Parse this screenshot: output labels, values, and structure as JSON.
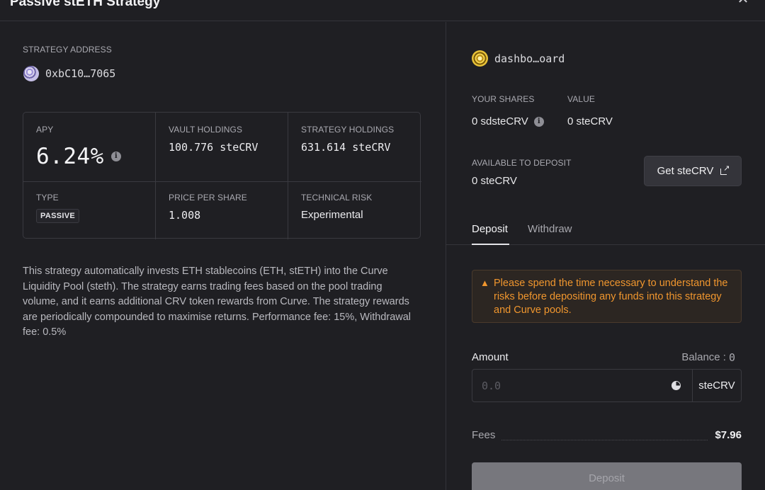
{
  "header": {
    "title": "Passive stETH Strategy",
    "close_glyph": "✕"
  },
  "strategy": {
    "address_label": "STRATEGY ADDRESS",
    "address": "0xbC10…7065",
    "stats": {
      "apy": {
        "label": "APY",
        "value": "6.24%"
      },
      "vault_holdings": {
        "label": "VAULT HOLDINGS",
        "value": "100.776 steCRV"
      },
      "strategy_holdings": {
        "label": "STRATEGY HOLDINGS",
        "value": "631.614 steCRV"
      },
      "type": {
        "label": "TYPE",
        "value": "PASSIVE"
      },
      "price_per_share": {
        "label": "PRICE PER SHARE",
        "value": "1.008"
      },
      "technical_risk": {
        "label": "TECHNICAL RISK",
        "value": "Experimental"
      }
    },
    "description": "This strategy automatically invests ETH stablecoins (ETH, stETH) into the Curve Liquidity Pool (steth). The strategy earns trading fees based on the pool trading volume, and it earns additional CRV token rewards from Curve. The strategy rewards are periodically compounded to maximise returns. Performance fee: 15%, Withdrawal fee: 0.5%"
  },
  "account": {
    "name": "dashbo…oard",
    "your_shares_label": "YOUR SHARES",
    "your_shares_value": "0 sdsteCRV",
    "value_label": "VALUE",
    "value_value": "0 steCRV",
    "available_label": "AVAILABLE TO DEPOSIT",
    "available_value": "0 steCRV",
    "get_button_label": "Get steCRV"
  },
  "tabs": {
    "deposit": "Deposit",
    "withdraw": "Withdraw",
    "active": "deposit"
  },
  "warning": {
    "icon": "warning-triangle",
    "text": "Please spend the time necessary to understand the risks before depositing any funds into this strategy and Curve pools."
  },
  "form": {
    "amount_label": "Amount",
    "balance_label": "Balance :",
    "balance_value": "0",
    "amount_placeholder": "0.0",
    "unit": "steCRV",
    "fees_label": "Fees",
    "fees_value": "$7.96",
    "submit_label": "Deposit"
  },
  "colors": {
    "background": "#1f1f23",
    "warning_text": "#f0962e",
    "disabled_button": "#77777d",
    "border": "#3a3a40"
  }
}
